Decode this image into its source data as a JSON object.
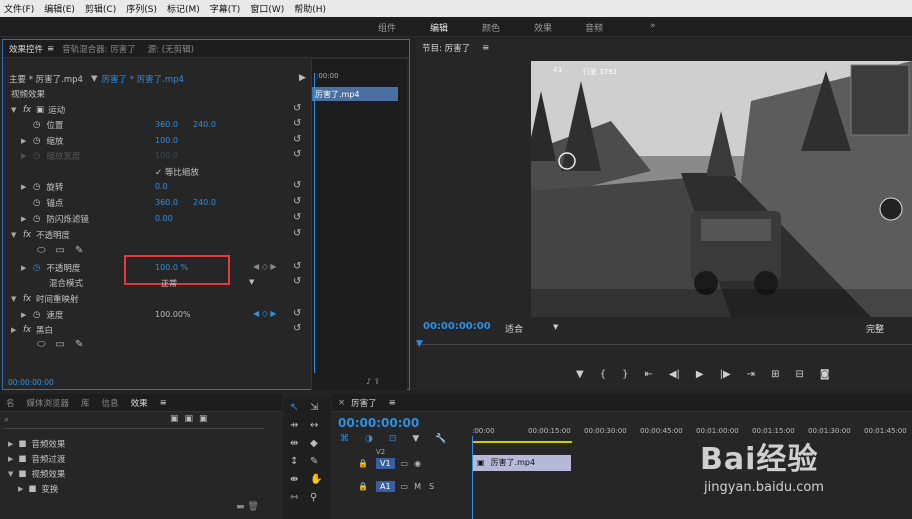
{
  "menu": [
    "文件(F)",
    "编辑(E)",
    "剪辑(C)",
    "序列(S)",
    "标记(M)",
    "字幕(T)",
    "窗口(W)",
    "帮助(H)"
  ],
  "workspaces": [
    "组件",
    "编辑",
    "颜色",
    "效果",
    "音频"
  ],
  "active_workspace": "编辑",
  "workspace_more": "»",
  "effect_controls": {
    "tabs": [
      "效果控件",
      "音轨混合器: 厉害了",
      "源: (无剪辑)"
    ],
    "master_label": "主要 * 厉害了.mp4",
    "sequence_label": "厉害了 * 厉害了.mp4",
    "video_effects": "视频效果",
    "motion": "运动",
    "position_label": "位置",
    "position_x": "360.0",
    "position_y": "240.0",
    "scale_label": "缩放",
    "scale_value": "100.0",
    "scale_width_label": "缩放宽度",
    "scale_width_value": "100.0",
    "uniform_scale": "✓ 等比缩放",
    "rotation_label": "旋转",
    "rotation_value": "0.0",
    "anchor_label": "锚点",
    "anchor_x": "360.0",
    "anchor_y": "240.0",
    "flicker_label": "防闪烁滤镜",
    "flicker_value": "0.00",
    "opacity_group": "不透明度",
    "opacity_label": "不透明度",
    "opacity_value": "100.0 %",
    "blend_label": "混合模式",
    "blend_value": "正常",
    "time_remap": "时间重映射",
    "speed_label": "速度",
    "speed_value": "100.00%",
    "black_white": "黑白",
    "clip_name": "厉害了.mp4",
    "ruler_start": ":00:00",
    "timecode": "00:00:00:00"
  },
  "program": {
    "title": "节目: 厉害了",
    "timecode": "00:00:00:00",
    "fit": "适合",
    "quality": "完整",
    "hud_top": "行驶 3792",
    "hud_count": "43"
  },
  "project": {
    "tabs": [
      "名",
      "媒体浏览器",
      "库",
      "信息",
      "效果"
    ],
    "active_tab": "效果",
    "items": [
      "音频效果",
      "音频过渡",
      "视频效果",
      "变换"
    ]
  },
  "timeline": {
    "title": "厉害了",
    "timecode": "00:00:00:00",
    "ruler": [
      ":00:00",
      "00:00:15:00",
      "00:00:30:00",
      "00:00:45:00",
      "00:01:00:00",
      "00:01:15:00",
      "00:01:30:00",
      "00:01:45:00"
    ],
    "tracks": [
      {
        "name": "V1",
        "type": "video"
      },
      {
        "name": "A1",
        "type": "audio"
      }
    ],
    "v2": "V2",
    "clip_name": "厉害了.mp4",
    "mute": "M",
    "solo": "S"
  },
  "watermark": {
    "text": "Bai经验",
    "url": "jingyan.baidu.com"
  },
  "colors": {
    "accent": "#2f8fe0",
    "highlight_box": "#e23b3b",
    "clip": "#b7b7d8"
  }
}
